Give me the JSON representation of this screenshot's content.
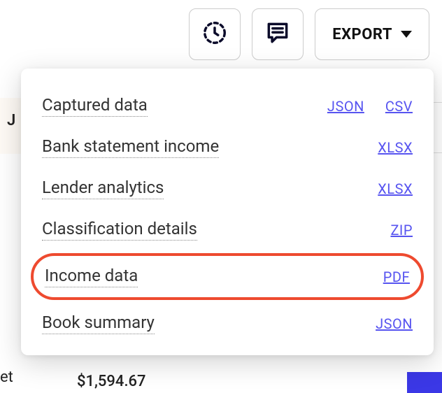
{
  "toolbar": {
    "export_label": "EXPORT"
  },
  "dropdown": {
    "rows": [
      {
        "label": "Captured data",
        "formats": [
          "JSON",
          "CSV"
        ],
        "highlighted": false
      },
      {
        "label": "Bank statement income",
        "formats": [
          "XLSX"
        ],
        "highlighted": false
      },
      {
        "label": "Lender analytics",
        "formats": [
          "XLSX"
        ],
        "highlighted": false
      },
      {
        "label": "Classification details",
        "formats": [
          "ZIP"
        ],
        "highlighted": false
      },
      {
        "label": "Income data",
        "formats": [
          "PDF"
        ],
        "highlighted": true
      },
      {
        "label": "Book summary",
        "formats": [
          "JSON"
        ],
        "highlighted": false
      }
    ]
  },
  "background": {
    "left_letter": "J",
    "bottom_left": "et",
    "bottom_price": "$1,594.67"
  }
}
